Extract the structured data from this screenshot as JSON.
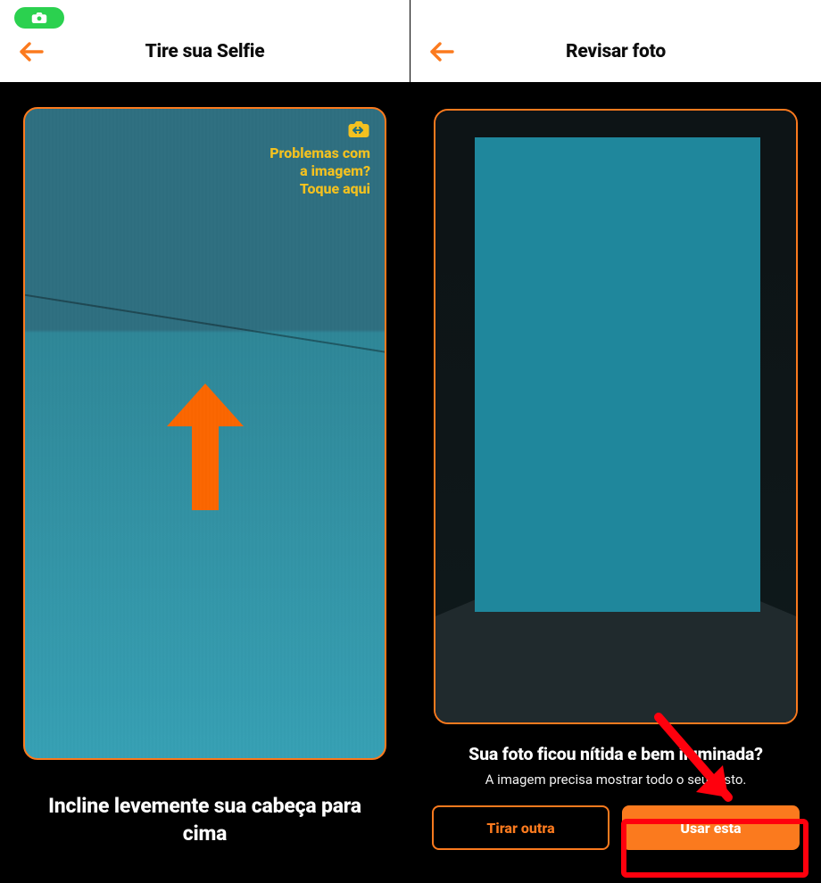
{
  "colors": {
    "accent": "#fb7a1e",
    "pill": "#2bd14f",
    "help": "#f4c21f",
    "annotation": "#ff000d"
  },
  "left": {
    "title": "Tire sua Selfie",
    "help_line1": "Problemas com",
    "help_line2": "a imagem?",
    "help_line3": "Toque aqui",
    "instruction": "Incline levemente sua cabeça para cima"
  },
  "right": {
    "title": "Revisar foto",
    "question": "Sua foto ficou nítida e bem iluminada?",
    "subtext": "A imagem precisa mostrar todo o seu rosto.",
    "btn_retake": "Tirar outra",
    "btn_use": "Usar esta"
  }
}
